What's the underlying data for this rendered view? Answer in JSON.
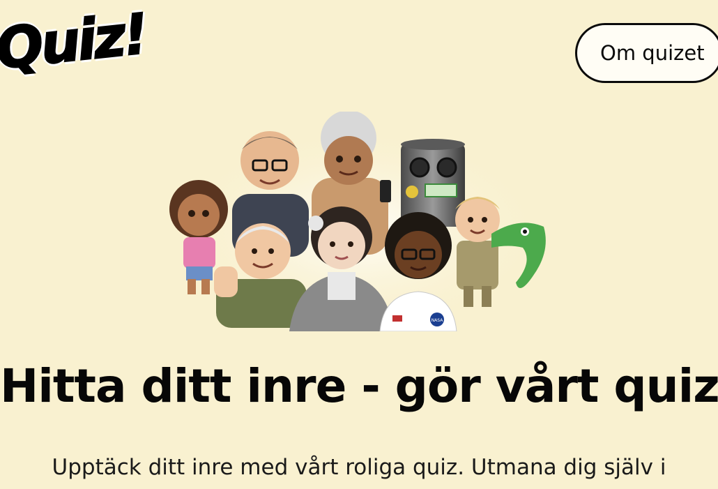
{
  "header": {
    "logo_text": "Quiz!",
    "about_button_label": "Om quizet"
  },
  "hero": {
    "image_icon": "group-of-famous-people-emoji-illustration",
    "badge_text": "NASA"
  },
  "main": {
    "title": "Hitta ditt inre - gör vårt quiz",
    "subtitle": "Upptäck ditt inre med vårt roliga quiz. Utmana dig själv i"
  },
  "colors": {
    "background": "#f9f1d0",
    "text": "#0b0b0b",
    "button_border": "#0a0a0a"
  }
}
